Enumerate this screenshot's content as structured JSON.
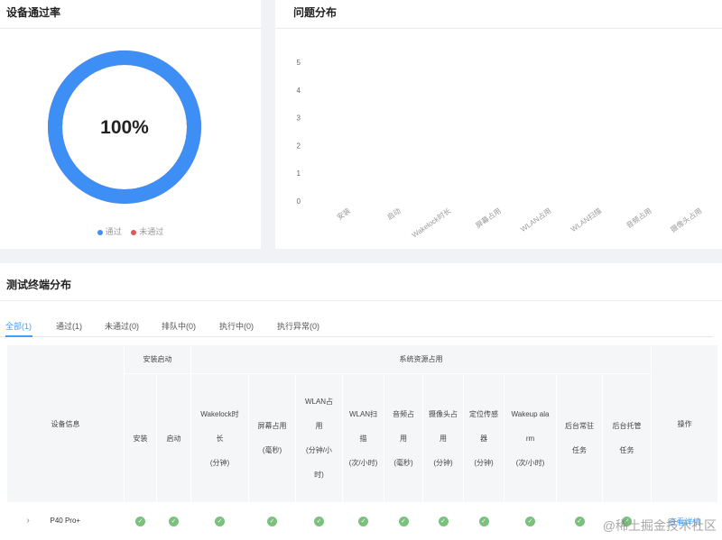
{
  "pass_card": {
    "title": "设备通过率",
    "percent_label": "100%",
    "pass_fraction": 1.0,
    "legend": [
      {
        "label": "通过",
        "color": "#3d8ff5"
      },
      {
        "label": "未通过",
        "color": "#e05656"
      }
    ]
  },
  "issue_card": {
    "title": "问题分布",
    "chart_data": {
      "type": "bar",
      "categories": [
        "安装",
        "启动",
        "Wakelock时长",
        "屏幕占用",
        "WLAN占用",
        "WLAN扫描",
        "音频占用",
        "摄像头占用"
      ],
      "values": [
        0,
        0,
        0,
        0,
        0,
        0,
        0,
        0
      ],
      "ylim": [
        0,
        5
      ],
      "yticks": [
        "0",
        "1",
        "2",
        "3",
        "4",
        "5"
      ]
    }
  },
  "term_card": {
    "title": "测试终端分布",
    "tabs": [
      "全部(1)",
      "通过(1)",
      "未通过(0)",
      "排队中(0)",
      "执行中(0)",
      "执行异常(0)"
    ],
    "headers": {
      "device_info": "设备信息",
      "install_launch": "安装启动",
      "system_resource": "系统资源占用",
      "install": "安装",
      "launch": "启动",
      "wakelock": [
        "Wakelock时",
        "长",
        "(分钟)"
      ],
      "screen": [
        "屏幕占用",
        "(毫秒)"
      ],
      "wlan_use": [
        "WLAN占",
        "用",
        "(分钟/小",
        "时)"
      ],
      "wlan_scan": [
        "WLAN扫",
        "描",
        "(次/小时)"
      ],
      "audio": [
        "音频占",
        "用",
        "(毫秒)"
      ],
      "camera": [
        "摄像头占",
        "用",
        "(分钟)"
      ],
      "location": [
        "定位传感",
        "器",
        "(分钟)"
      ],
      "wakeup": [
        "Wakeup ala",
        "rm",
        "(次/小时)"
      ],
      "bg_resident": [
        "后台常驻",
        "任务"
      ],
      "bg_hosted": [
        "后台托管",
        "任务"
      ],
      "action": "操作"
    },
    "rows": [
      {
        "device": "P40 Pro+",
        "action": "查看详情"
      }
    ],
    "watermark": "@稀土掘金技术社区"
  }
}
